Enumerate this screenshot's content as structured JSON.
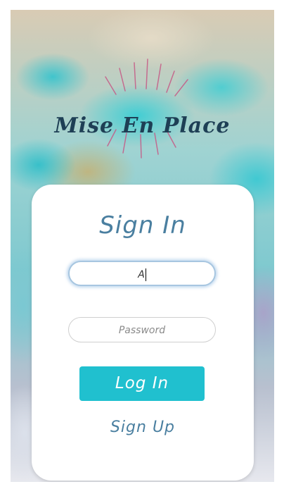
{
  "brand": {
    "logo_text": "Mise En Place"
  },
  "signin": {
    "title": "Sign In",
    "username_value": "A",
    "password_placeholder": "Password",
    "login_label": "Log In",
    "signup_label": "Sign Up"
  },
  "colors": {
    "accent": "#20c0cf",
    "title": "#4a7fa0",
    "logo": "#1e3f55",
    "rays": "#c65a86"
  }
}
